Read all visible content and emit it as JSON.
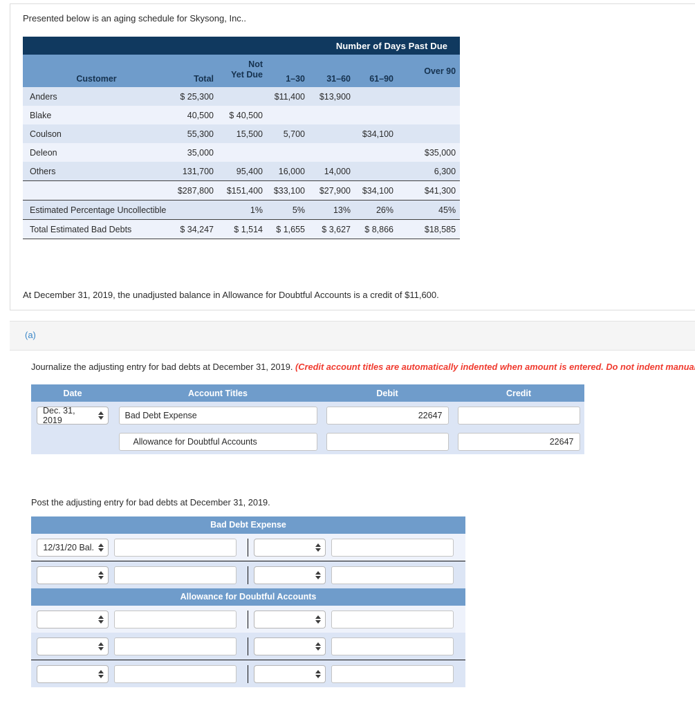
{
  "problem": {
    "intro": "Presented below is an aging schedule for Skysong, Inc..",
    "closing": "At December 31, 2019, the unadjusted balance in Allowance for Doubtful Accounts is a credit of $11,600."
  },
  "aging_table": {
    "group_header": "Number of Days Past Due",
    "columns": [
      "Customer",
      "Total",
      "Not Yet Due",
      "1–30",
      "31–60",
      "61–90",
      "Over 90"
    ],
    "col_not_yet_due_line1": "Not",
    "col_not_yet_due_line2": "Yet Due",
    "rows": [
      {
        "customer": "Anders",
        "total": "$ 25,300",
        "not_yet_due": "",
        "d1_30": "$11,400",
        "d31_60": "$13,900",
        "d61_90": "",
        "over_90": ""
      },
      {
        "customer": "Blake",
        "total": "40,500",
        "not_yet_due": "$ 40,500",
        "d1_30": "",
        "d31_60": "",
        "d61_90": "",
        "over_90": ""
      },
      {
        "customer": "Coulson",
        "total": "55,300",
        "not_yet_due": "15,500",
        "d1_30": "5,700",
        "d31_60": "",
        "d61_90": "$34,100",
        "over_90": ""
      },
      {
        "customer": "Deleon",
        "total": "35,000",
        "not_yet_due": "",
        "d1_30": "",
        "d31_60": "",
        "d61_90": "",
        "over_90": "$35,000"
      },
      {
        "customer": "Others",
        "total": "131,700",
        "not_yet_due": "95,400",
        "d1_30": "16,000",
        "d31_60": "14,000",
        "d61_90": "",
        "over_90": "6,300"
      }
    ],
    "totals_row": {
      "customer": "",
      "total": "$287,800",
      "not_yet_due": "$151,400",
      "d1_30": "$33,100",
      "d31_60": "$27,900",
      "d61_90": "$34,100",
      "over_90": "$41,300"
    },
    "percent_row": {
      "customer": "Estimated Percentage Uncollectible",
      "total": "",
      "not_yet_due": "1%",
      "d1_30": "5%",
      "d31_60": "13%",
      "d61_90": "26%",
      "over_90": "45%"
    },
    "bad_debt_row": {
      "customer": "Total Estimated Bad Debts",
      "total": "$ 34,247",
      "not_yet_due": "$ 1,514",
      "d1_30": "$ 1,655",
      "d31_60": "$ 3,627",
      "d61_90": "$ 8,866",
      "over_90": "$18,585"
    }
  },
  "part": {
    "label": "(a)",
    "question_text": "Journalize the adjusting entry for bad debts at December 31, 2019. ",
    "question_note": "(Credit account titles are automatically indented when amount is entered. Do not indent manually.)",
    "post_text": "Post the adjusting entry for bad debts at December 31, 2019."
  },
  "journal": {
    "headers": {
      "date": "Date",
      "account_titles": "Account Titles",
      "debit": "Debit",
      "credit": "Credit"
    },
    "rows": [
      {
        "date": "Dec. 31, 2019",
        "account_title": "Bad Debt Expense",
        "debit": "22647",
        "credit": "",
        "indented": false
      },
      {
        "date": "",
        "account_title": "Allowance for Doubtful Accounts",
        "debit": "",
        "credit": "22647",
        "indented": true
      }
    ]
  },
  "t_accounts": [
    {
      "title": "Bad Debt Expense",
      "rows": [
        {
          "left_select": "12/31/20 Bal.",
          "left_amount": "",
          "right_select": "",
          "right_amount": ""
        },
        {
          "left_select": "",
          "left_amount": "",
          "right_select": "",
          "right_amount": ""
        }
      ]
    },
    {
      "title": "Allowance for Doubtful Accounts",
      "rows": [
        {
          "left_select": "",
          "left_amount": "",
          "right_select": "",
          "right_amount": ""
        },
        {
          "left_select": "",
          "left_amount": "",
          "right_select": "",
          "right_amount": ""
        },
        {
          "left_select": "",
          "left_amount": "",
          "right_select": "",
          "right_amount": ""
        }
      ]
    }
  ],
  "colors": {
    "navy_header": "#10395f",
    "blue_header": "#6f9ccb",
    "row_dark": "#dce5f3",
    "row_light": "#eef2fb",
    "note_red": "#f03a2e",
    "part_link": "#3a87c8"
  }
}
